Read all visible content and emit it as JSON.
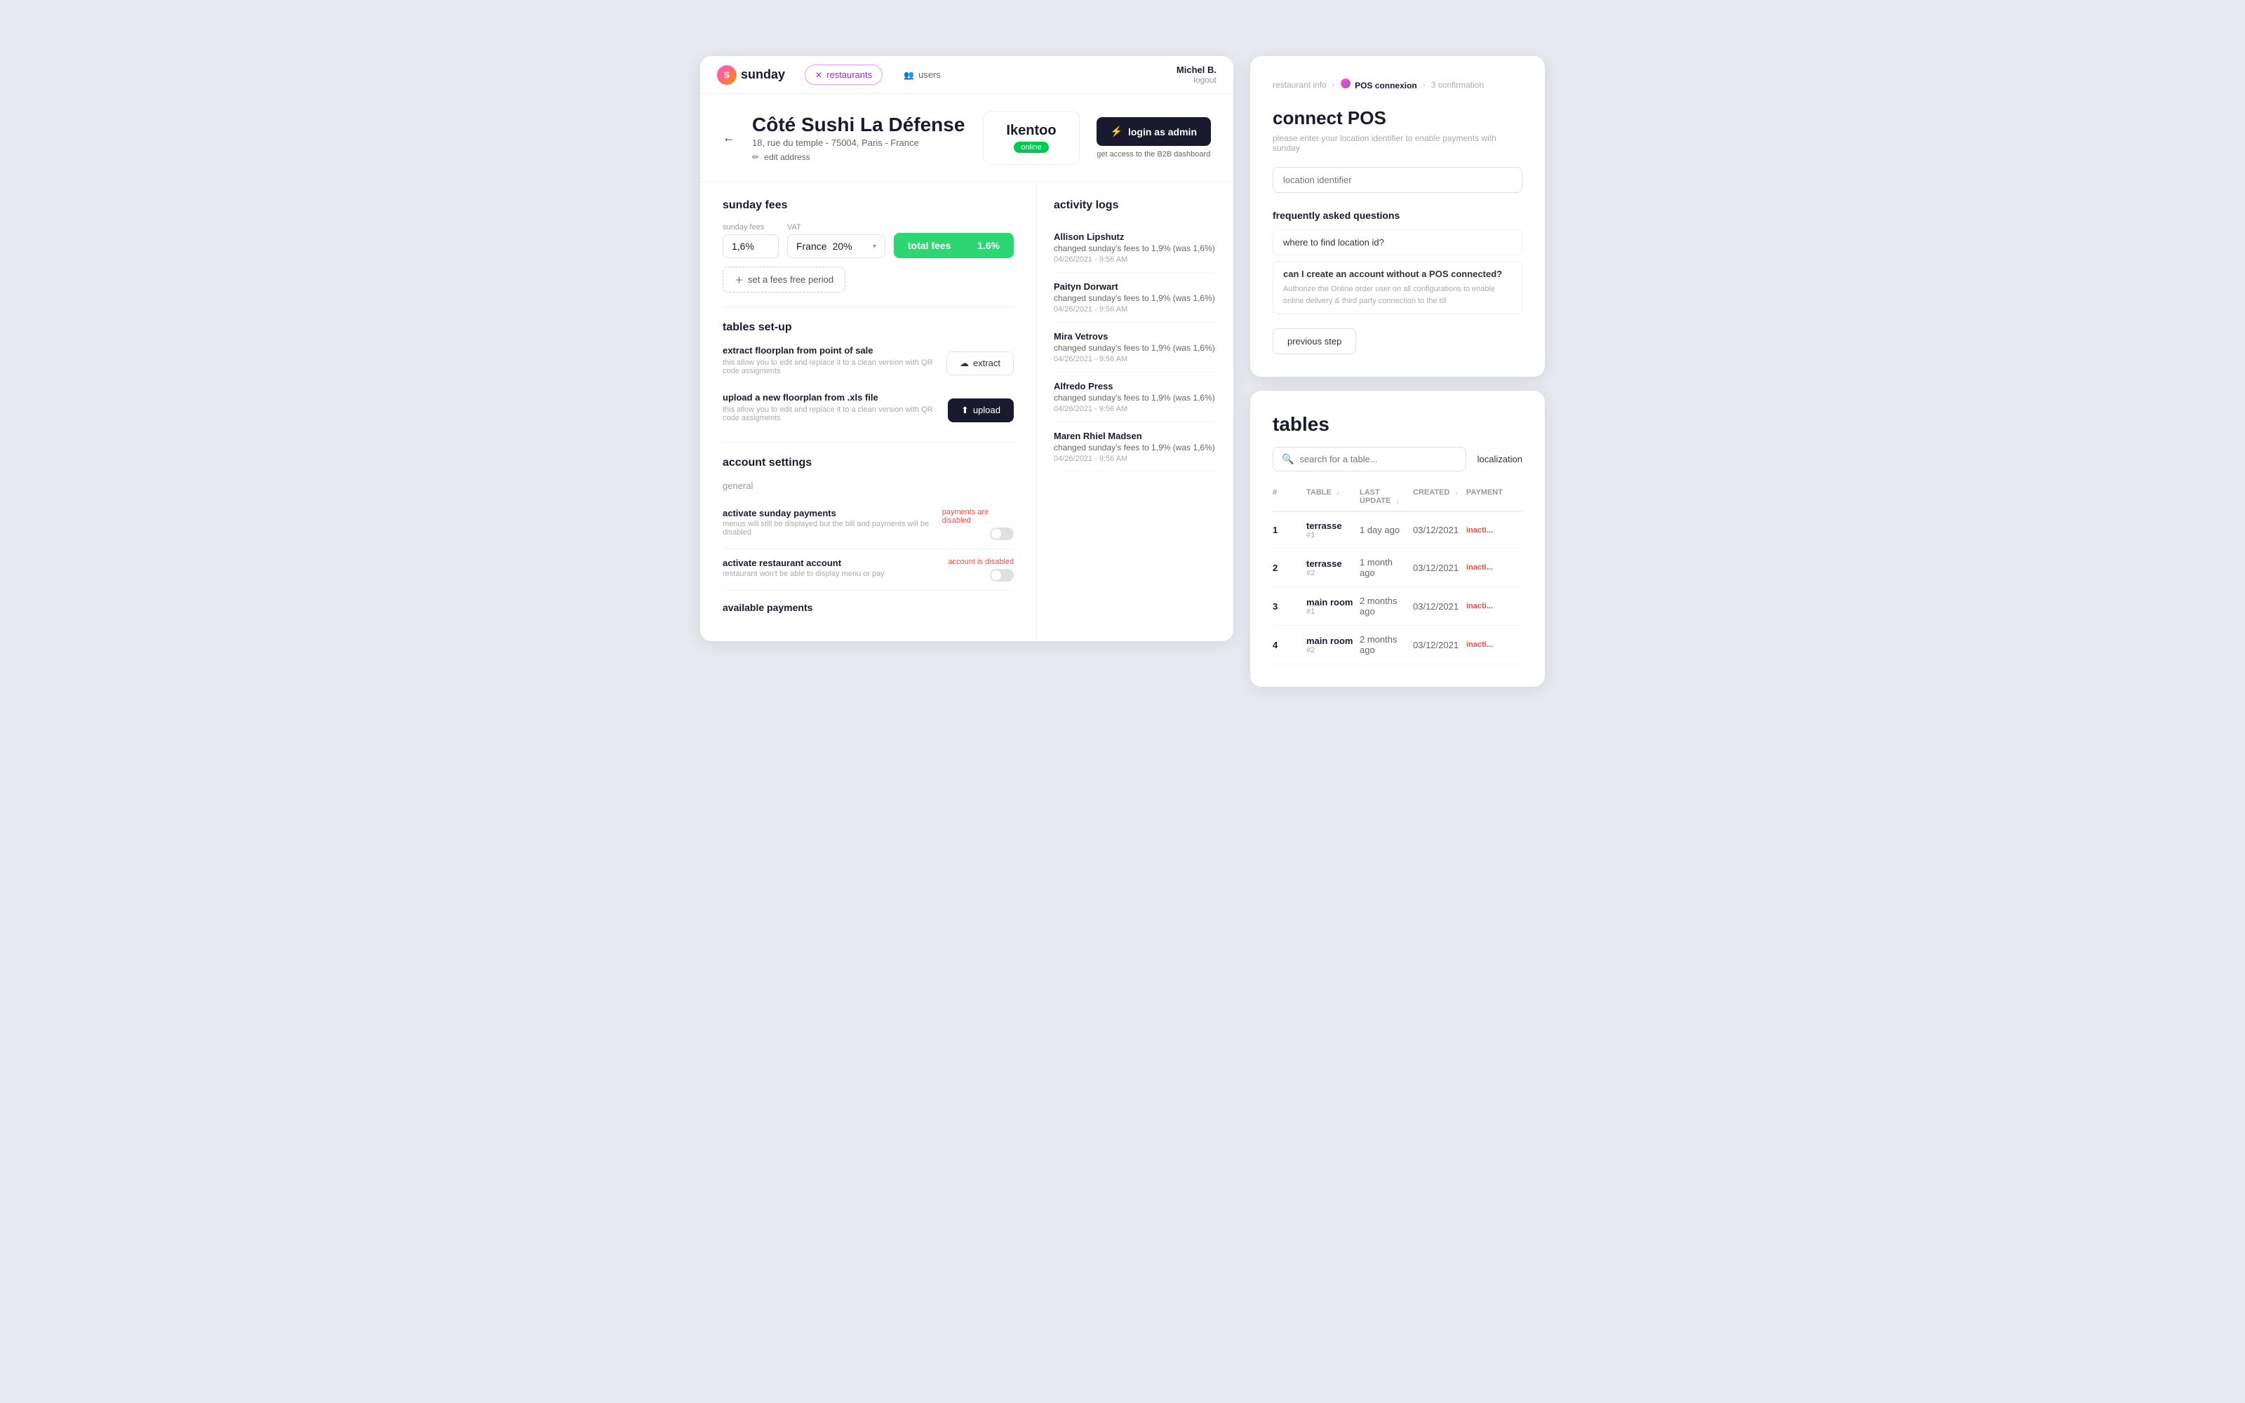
{
  "header": {
    "logo_text": "sunday",
    "tabs": [
      {
        "id": "restaurants",
        "label": "restaurants",
        "active": true,
        "icon": "✕"
      },
      {
        "id": "users",
        "label": "users",
        "active": false,
        "icon": "👥"
      }
    ],
    "user_name": "Michel B.",
    "logout_label": "logout"
  },
  "restaurant": {
    "name": "Côté Sushi La Défense",
    "address": "18, rue du temple - 75004, Paris - France",
    "edit_address_label": "edit address",
    "pos_name": "Ikentoo",
    "pos_status": "online",
    "login_btn_label": "login as admin",
    "login_btn_sub": "get access to the B2B dashboard"
  },
  "sunday_fees": {
    "section_title": "sunday fees",
    "fees_label": "sunday fees",
    "fees_value": "1,6%",
    "vat_label": "VAT",
    "vat_country": "France",
    "vat_percent": "20%",
    "total_fees_label": "total fees",
    "total_fees_value": "1.6%",
    "fees_free_btn_label": "set a fees free period"
  },
  "tables_setup": {
    "section_title": "tables set-up",
    "extract_label": "extract floorplan from point of sale",
    "extract_sub": "this allow you to edit and replace it to a clean version with QR code assigments",
    "extract_btn": "extract",
    "upload_label": "upload a new floorplan from .xls file",
    "upload_sub": "this allow you to edit and replace it to a clean version with QR code assigments",
    "upload_btn": "upload"
  },
  "account_settings": {
    "section_title": "account settings",
    "general_label": "general",
    "payments_label": "activate sunday payments",
    "payments_sub": "menus will still be displayed but the bill and payments will be disabled",
    "payments_status": "payments are disabled",
    "account_label": "activate restaurant account",
    "account_sub": "restaurant won't be able to display menu or pay",
    "account_status": "account is disabled",
    "available_payments_label": "available payments"
  },
  "activity_logs": {
    "section_title": "activity logs",
    "entries": [
      {
        "user": "Allison Lipshutz",
        "action": "changed sunday's fees to 1,9% (was 1,6%)",
        "time": "04/26/2021 - 9:56 AM"
      },
      {
        "user": "Paityn Dorwart",
        "action": "changed sunday's fees to 1,9% (was 1,6%)",
        "time": "04/26/2021 - 9:56 AM"
      },
      {
        "user": "Mira Vetrovs",
        "action": "changed sunday's fees to 1,9% (was 1,6%)",
        "time": "04/26/2021 - 9:56 AM"
      },
      {
        "user": "Alfredo Press",
        "action": "changed sunday's fees to 1,9% (was 1,6%)",
        "time": "04/26/2021 - 9:56 AM"
      },
      {
        "user": "Maren Rhiel Madsen",
        "action": "changed sunday's fees to 1,9% (was 1,6%)",
        "time": "04/26/2021 - 9:56 AM"
      }
    ]
  },
  "connect_pos": {
    "step1_label": "restaurant info",
    "step2_label": "POS connexion",
    "step3_label": "3",
    "step3_sub": "confirmation",
    "title": "connect POS",
    "subtitle": "please enter your location identifier to enable payments with sunday",
    "location_placeholder": "location identifier",
    "faq_title": "frequently asked questions",
    "faq_items": [
      {
        "question": "where to find location id?",
        "expanded": false
      },
      {
        "question": "can I create an account without a POS connected?",
        "expanded": true,
        "answer": "Authorize the Online order user on all configurations to enable online delivery & third party connection to the till"
      }
    ],
    "previous_step_btn": "previous step"
  },
  "tables_panel": {
    "title": "tables",
    "search_placeholder": "search for a table...",
    "localization_label": "localization",
    "columns": [
      "TABLE",
      "LAST UPDATE",
      "CREATED",
      "PAYMENT"
    ],
    "rows": [
      {
        "num": 1,
        "name": "terrasse",
        "sub": "#1",
        "last_update": "1 day ago",
        "created": "03/12/2021",
        "status": "inacti..."
      },
      {
        "num": 2,
        "name": "terrasse",
        "sub": "#2",
        "last_update": "1 month ago",
        "created": "03/12/2021",
        "status": "inacti..."
      },
      {
        "num": 3,
        "name": "main room",
        "sub": "#1",
        "last_update": "2 months ago",
        "created": "03/12/2021",
        "status": "inacti..."
      },
      {
        "num": 4,
        "name": "main room",
        "sub": "#2",
        "last_update": "2 months ago",
        "created": "03/12/2021",
        "status": "inacti..."
      }
    ]
  }
}
